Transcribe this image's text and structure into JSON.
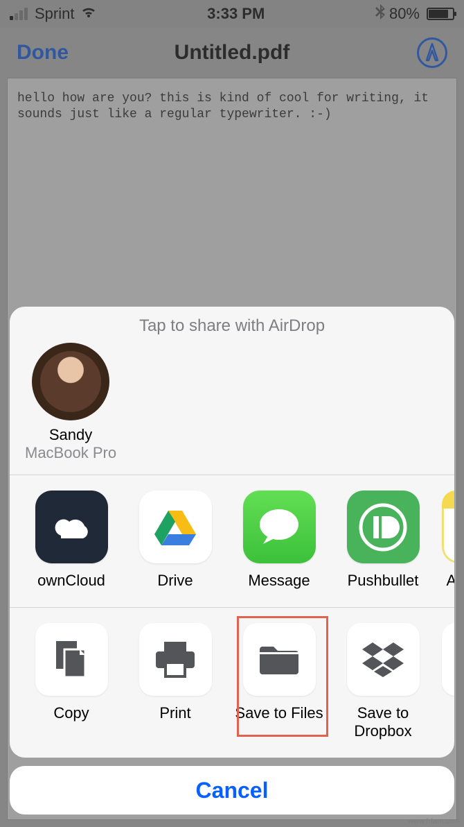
{
  "status_bar": {
    "carrier": "Sprint",
    "time": "3:33 PM",
    "battery_pct": "80%"
  },
  "nav": {
    "done": "Done",
    "title": "Untitled.pdf"
  },
  "document": {
    "text": "hello how are you? this is kind of cool for writing, it sounds just like a regular typewriter. :-)"
  },
  "share_sheet": {
    "header": "Tap to share with AirDrop",
    "airdrop": {
      "name": "Sandy",
      "device": "MacBook Pro"
    },
    "apps": [
      {
        "label": "ownCloud",
        "icon": "owncloud"
      },
      {
        "label": "Drive",
        "icon": "drive"
      },
      {
        "label": "Message",
        "icon": "message"
      },
      {
        "label": "Pushbullet",
        "icon": "pushbullet"
      },
      {
        "label": "Ad",
        "icon": "notes"
      }
    ],
    "actions": [
      {
        "label": "Copy",
        "icon": "copy"
      },
      {
        "label": "Print",
        "icon": "print"
      },
      {
        "label": "Save to Files",
        "icon": "files",
        "highlighted": true
      },
      {
        "label": "Save to\nDropbox",
        "icon": "dropbox"
      }
    ],
    "cancel": "Cancel"
  },
  "watermark": "www.frfam.com"
}
